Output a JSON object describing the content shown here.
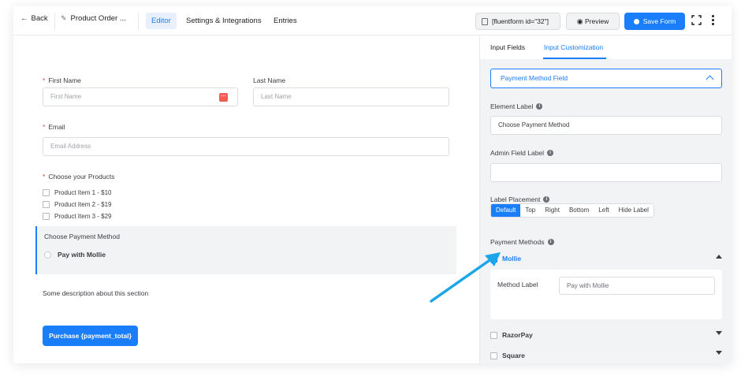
{
  "header": {
    "back_label": "Back",
    "form_title": "Product Order ...",
    "tabs": [
      {
        "label": "Editor",
        "active": true
      },
      {
        "label": "Settings & Integrations",
        "active": false
      },
      {
        "label": "Entries",
        "active": false
      }
    ],
    "shortcode": "[fluentform id=\"32\"]",
    "preview_label": "Preview",
    "save_label": "Save Form"
  },
  "form": {
    "first_name_label": "First Name",
    "first_name_placeholder": "First Name",
    "last_name_label": "Last Name",
    "last_name_placeholder": "Last Name",
    "email_label": "Email",
    "email_placeholder": "Email Address",
    "products_label": "Choose your Products",
    "products": [
      "Product Item 1 - $10",
      "Product Item 2 - $19",
      "Product Item 3 - $29"
    ],
    "payment_label": "Choose Payment Method",
    "payment_option": "Pay with Mollie",
    "description": "Some description about this section",
    "submit_label": "Purchase {payment_total}"
  },
  "panel": {
    "tabs": [
      {
        "label": "Input Fields",
        "active": false
      },
      {
        "label": "Input Customization",
        "active": true
      }
    ],
    "section_title": "Payment Method Field",
    "element_label_title": "Element Label",
    "element_label_value": "Choose Payment Method",
    "admin_label_title": "Admin Field Label",
    "admin_label_value": "",
    "placement_title": "Label Placement",
    "placement_options": [
      {
        "label": "Default",
        "selected": true
      },
      {
        "label": "Top",
        "selected": false
      },
      {
        "label": "Right",
        "selected": false
      },
      {
        "label": "Bottom",
        "selected": false
      },
      {
        "label": "Left",
        "selected": false
      },
      {
        "label": "Hide Label",
        "selected": false
      }
    ],
    "methods_title": "Payment Methods",
    "methods": [
      {
        "name": "Mollie",
        "checked": true,
        "expanded": true
      },
      {
        "name": "RazorPay",
        "checked": false,
        "expanded": false
      },
      {
        "name": "Square",
        "checked": false,
        "expanded": false
      }
    ],
    "method_label_title": "Method Label",
    "method_label_value": "Pay with Mollie"
  },
  "colors": {
    "accent": "#1a7efb",
    "annotation_arrow": "#1aa6e8",
    "required": "#e74c3c"
  }
}
